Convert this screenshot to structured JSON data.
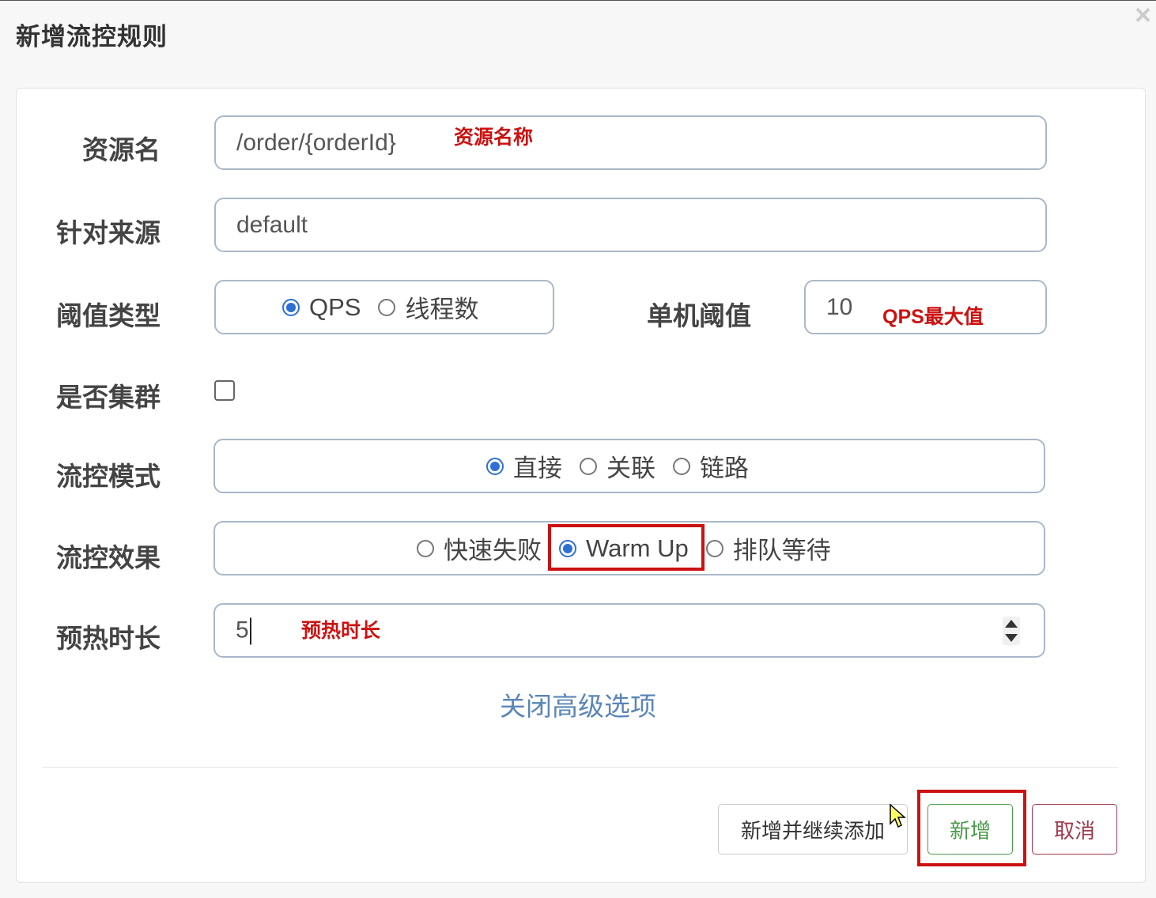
{
  "dialog": {
    "title": "新增流控规则",
    "close_icon": "×"
  },
  "form": {
    "resource": {
      "label": "资源名",
      "value": "/order/{orderId}",
      "annotation": "资源名称"
    },
    "origin": {
      "label": "针对来源",
      "value": "default"
    },
    "threshold_type": {
      "label": "阈值类型",
      "options": [
        "QPS",
        "线程数"
      ],
      "selected": "QPS"
    },
    "threshold": {
      "label": "单机阈值",
      "value": "10",
      "annotation": "QPS最大值"
    },
    "cluster": {
      "label": "是否集群",
      "checked": false
    },
    "control_mode": {
      "label": "流控模式",
      "options": [
        "直接",
        "关联",
        "链路"
      ],
      "selected": "直接"
    },
    "control_effect": {
      "label": "流控效果",
      "options": [
        "快速失败",
        "Warm Up",
        "排队等待"
      ],
      "selected": "Warm Up"
    },
    "warmup": {
      "label": "预热时长",
      "value": "5",
      "annotation": "预热时长"
    },
    "advanced_link": "关闭高级选项"
  },
  "footer": {
    "add_continue_label": "新增并继续添加",
    "add_label": "新增",
    "cancel_label": "取消"
  },
  "colors": {
    "accent": "#2e6fd6",
    "annotation": "#cc1111",
    "link": "#5a86b8",
    "add_button": "#4a9a4a",
    "cancel_button": "#a0384e"
  }
}
